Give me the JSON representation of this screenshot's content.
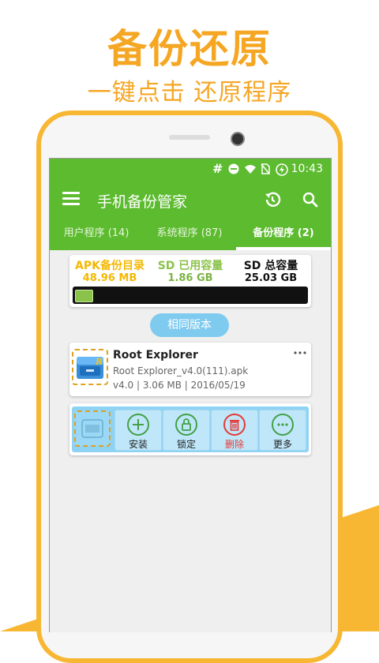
{
  "promo": {
    "headline": "备份还原",
    "subheadline": "一键点击 还原程序",
    "accent_color": "#f5a623"
  },
  "status_bar": {
    "icons": [
      "hash-icon",
      "dnd-icon",
      "wifi-icon",
      "sim-icon",
      "battery-charging-icon"
    ],
    "hash": "#",
    "time": "10:43"
  },
  "app_bar": {
    "title": "手机备份管家",
    "color": "#5dbb2f"
  },
  "tabs": [
    {
      "label": "用户程序 (14)",
      "active": false
    },
    {
      "label": "系统程序 (87)",
      "active": false
    },
    {
      "label": "备份程序 (2)",
      "active": true
    }
  ],
  "stats": {
    "apk_dir": {
      "label": "APK备份目录",
      "value": "48.96 MB",
      "color": "#f5b800"
    },
    "sd_used": {
      "label": "SD 已用容量",
      "value": "1.86 GB",
      "color": "#8bc34a"
    },
    "sd_total": {
      "label": "SD 总容量",
      "value": "25.03 GB",
      "color": "#111111"
    },
    "used_fraction": 0.074
  },
  "same_version_button": "相同版本",
  "app_item": {
    "name": "Root Explorer",
    "file": "Root Explorer_v4.0(111).apk",
    "meta": "v4.0 | 3.06 MB | 2016/05/19",
    "overflow": "⋮"
  },
  "actions": [
    {
      "key": "install",
      "label": "安装"
    },
    {
      "key": "lock",
      "label": "锁定"
    },
    {
      "key": "delete",
      "label": "删除"
    },
    {
      "key": "more",
      "label": "更多"
    }
  ]
}
